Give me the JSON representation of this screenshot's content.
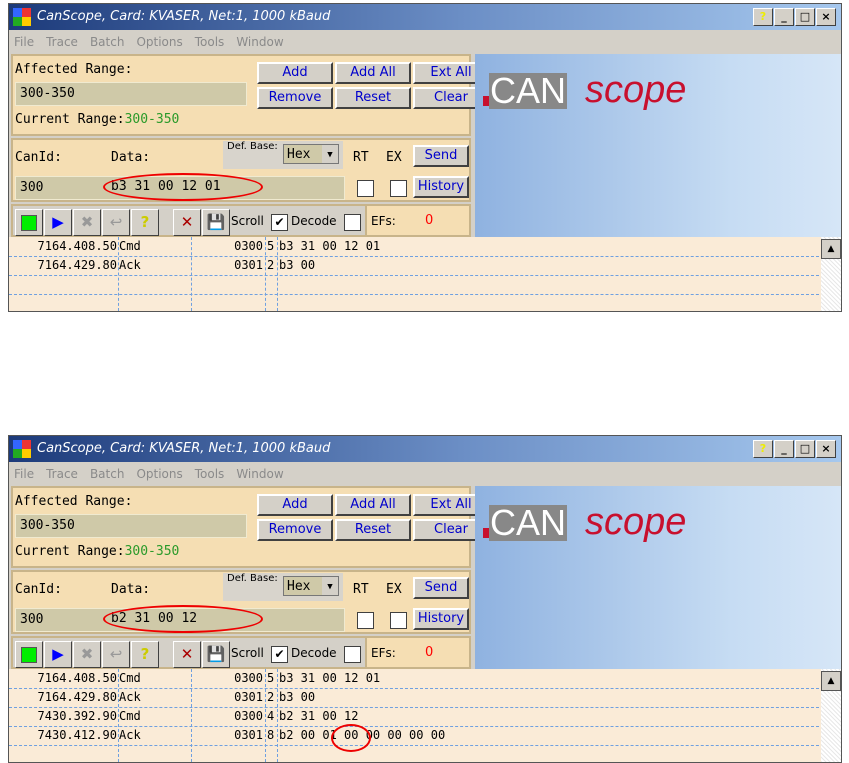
{
  "windows": [
    {
      "title": "CanScope, Card: KVASER, Net:1, 1000 kBaud",
      "title_buttons": {
        "help": "?",
        "minimize": "_",
        "maximize": "□",
        "close": "×"
      },
      "menu": [
        "File",
        "Trace",
        "Batch",
        "Options",
        "Tools",
        "Window"
      ],
      "range": {
        "label": "Affected Range:",
        "value": "300-350",
        "current_label": "Current Range:",
        "current_value": "300-350",
        "buttons": [
          "Add",
          "Add All",
          "Ext All",
          "Remove",
          "Reset",
          "Clear"
        ]
      },
      "send": {
        "canid_label": "CanId:",
        "data_label": "Data:",
        "defbase_label": "Def. Base:",
        "base": "Hex",
        "rt_label": "RT",
        "ex_label": "EX",
        "send_label": "Send",
        "history_label": "History",
        "canid": "300",
        "data": "b3 31 00 12 01",
        "rt": false,
        "ex": false
      },
      "toolbar": {
        "scroll_label": "Scroll",
        "scroll": true,
        "decode_label": "Decode",
        "decode": false,
        "efs_label": "EFs:",
        "efs": "0"
      },
      "rows": [
        {
          "time": "7164.408.50",
          "type": "Cmd",
          "id": "0300",
          "dlc": "5",
          "data": "b3 31 00 12 01"
        },
        {
          "time": "7164.429.80",
          "type": "Ack",
          "id": "0301",
          "dlc": "2",
          "data": "b3 00"
        }
      ],
      "empty_rows": 2
    },
    {
      "title": "CanScope, Card: KVASER, Net:1, 1000 kBaud",
      "title_buttons": {
        "help": "?",
        "minimize": "_",
        "maximize": "□",
        "close": "×"
      },
      "menu": [
        "File",
        "Trace",
        "Batch",
        "Options",
        "Tools",
        "Window"
      ],
      "range": {
        "label": "Affected Range:",
        "value": "300-350",
        "current_label": "Current Range:",
        "current_value": "300-350",
        "buttons": [
          "Add",
          "Add All",
          "Ext All",
          "Remove",
          "Reset",
          "Clear"
        ]
      },
      "send": {
        "canid_label": "CanId:",
        "data_label": "Data:",
        "defbase_label": "Def. Base:",
        "base": "Hex",
        "rt_label": "RT",
        "ex_label": "EX",
        "send_label": "Send",
        "history_label": "History",
        "canid": "300",
        "data": "b2 31 00 12",
        "rt": false,
        "ex": false
      },
      "toolbar": {
        "scroll_label": "Scroll",
        "scroll": true,
        "decode_label": "Decode",
        "decode": false,
        "efs_label": "EFs:",
        "efs": "0"
      },
      "rows": [
        {
          "time": "7164.408.50",
          "type": "Cmd",
          "id": "0300",
          "dlc": "5",
          "data": "b3 31 00 12 01"
        },
        {
          "time": "7164.429.80",
          "type": "Ack",
          "id": "0301",
          "dlc": "2",
          "data": "b3 00"
        },
        {
          "time": "7430.392.90",
          "type": "Cmd",
          "id": "0300",
          "dlc": "4",
          "data": "b2 31 00 12"
        },
        {
          "time": "7430.412.90",
          "type": "Ack",
          "id": "0301",
          "dlc": "8",
          "data": "b2 00 01 00 00 00 00 00"
        }
      ],
      "empty_rows": 1
    }
  ],
  "logo": {
    "can": "CAN",
    "scope": "scope"
  },
  "colors": {
    "accent_red": "#c8102e",
    "current_range": "#2a9a2a",
    "link_blue": "#0000cc"
  }
}
